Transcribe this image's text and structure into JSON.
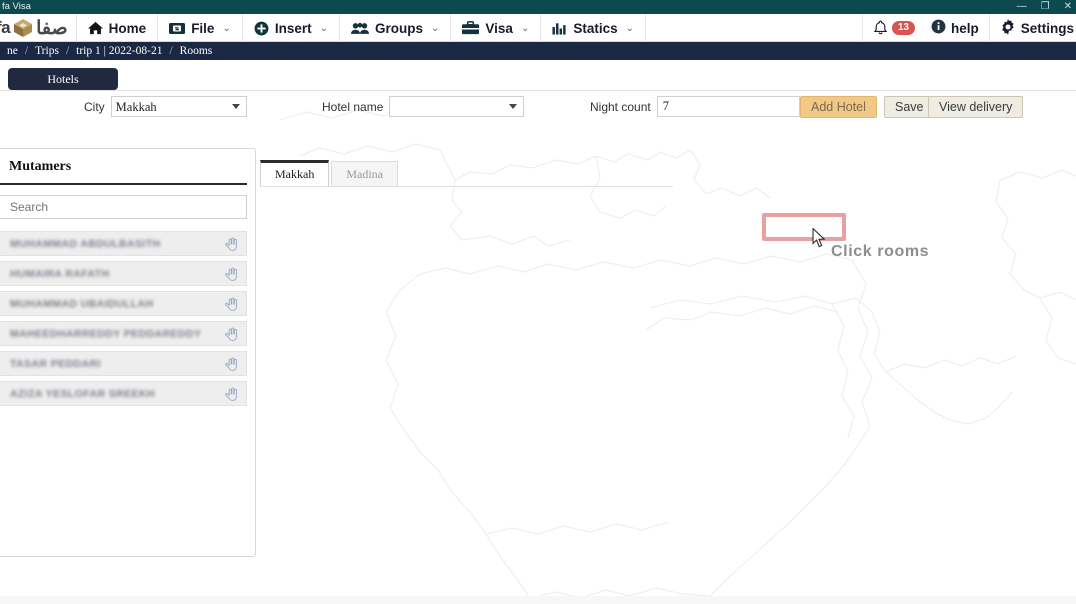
{
  "window": {
    "title": "fa Visa",
    "minimize": "—",
    "maximize": "❐",
    "close": "✕"
  },
  "brand": {
    "latin": "fa",
    "arabic": "صفا",
    "cube_icon": "cube-logo-icon"
  },
  "menu": {
    "items": [
      {
        "label": "Home",
        "icon": "home-icon",
        "caret": ""
      },
      {
        "label": "File",
        "icon": "folder-icon",
        "caret": "⌄"
      },
      {
        "label": "Insert",
        "icon": "plus-circle-icon",
        "caret": "⌄"
      },
      {
        "label": "Groups",
        "icon": "people-icon",
        "caret": "⌄"
      },
      {
        "label": "Visa",
        "icon": "briefcase-icon",
        "caret": "⌄"
      },
      {
        "label": "Statics",
        "icon": "bar-chart-icon",
        "caret": "⌄"
      }
    ],
    "notification_count": "13",
    "help_label": "help",
    "settings_label": "Settings"
  },
  "breadcrumb": {
    "items": [
      "ne",
      "Trips",
      "trip 1 | 2022-08-21",
      "Rooms"
    ],
    "separator": "/"
  },
  "toolbar": {
    "hotels_tab": "Hotels",
    "city_label": "City",
    "city_value": "Makkah",
    "city_options": [
      "Makkah",
      "Madina"
    ],
    "hotel_name_label": "Hotel name",
    "hotel_name_value": "",
    "hotel_name_options": [
      ""
    ],
    "night_count_label": "Night count",
    "night_count_value": "7",
    "add_hotel_label": "Add Hotel",
    "save_label": "Save",
    "view_delivery_label": "View delivery"
  },
  "sidebar": {
    "title": "Mutamers",
    "search_placeholder": "Search",
    "search_value": "",
    "customers": [
      {
        "name": "MUHAMMAD ABDULBASITH",
        "action_icon": "hand-pointer-icon"
      },
      {
        "name": "HUMAIRA RAFATH",
        "action_icon": "hand-pointer-icon"
      },
      {
        "name": "MUHAMMAD UBAIDULLAH",
        "action_icon": "hand-pointer-icon"
      },
      {
        "name": "MAHEEDHARREDDY PEDDAREDDY",
        "action_icon": "hand-pointer-icon"
      },
      {
        "name": "TASAR PEDDARI",
        "action_icon": "hand-pointer-icon"
      },
      {
        "name": "AZIZA YESLOFAR SREEKH",
        "action_icon": "hand-pointer-icon"
      }
    ]
  },
  "content": {
    "tabs": [
      {
        "label": "Makkah",
        "active": true
      },
      {
        "label": "Madina",
        "active": false
      }
    ]
  },
  "annotation": {
    "text": "Click rooms",
    "highlight_color": "#e8a0a0",
    "text_color": "#8d8d8d",
    "cursor_icon": "mouse-pointer-icon"
  },
  "colors": {
    "titlebar": "#0d4a50",
    "breadcrumb": "#1b2844",
    "hotels_pill": "#20293f",
    "primary_button": "#f2c886",
    "badge": "#d9534f"
  }
}
